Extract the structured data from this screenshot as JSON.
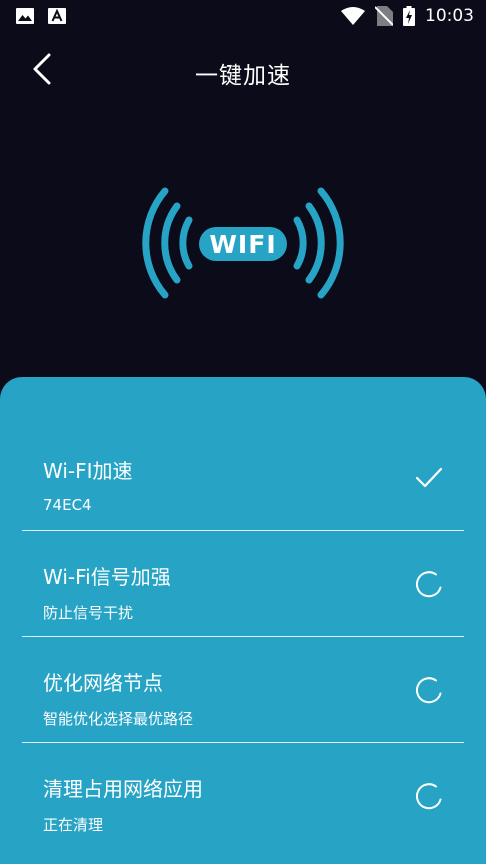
{
  "status_bar": {
    "time": "10:03",
    "left_icons": [
      "image-icon",
      "font-a-icon"
    ],
    "right_icons": [
      "wifi-signal-icon",
      "no-sim-icon",
      "battery-charging-icon"
    ]
  },
  "header": {
    "title": "一键加速",
    "back_icon": "back-arrow-icon"
  },
  "illustration": {
    "label": "WIFI",
    "color": "#27a4c5"
  },
  "colors": {
    "background": "#0b0b1a",
    "panel": "#27a4c5",
    "text": "#ffffff"
  },
  "tasks": [
    {
      "title": "Wi-FI加速",
      "subtitle": "74EC4",
      "status": "done",
      "status_icon": "checkmark-icon"
    },
    {
      "title": "Wi-Fi信号加强",
      "subtitle": "防止信号干扰",
      "status": "loading",
      "status_icon": "spinner-icon"
    },
    {
      "title": "优化网络节点",
      "subtitle": "智能优化选择最优路径",
      "status": "loading",
      "status_icon": "spinner-icon"
    },
    {
      "title": "清理占用网络应用",
      "subtitle": "正在清理",
      "status": "loading",
      "status_icon": "spinner-icon"
    }
  ]
}
